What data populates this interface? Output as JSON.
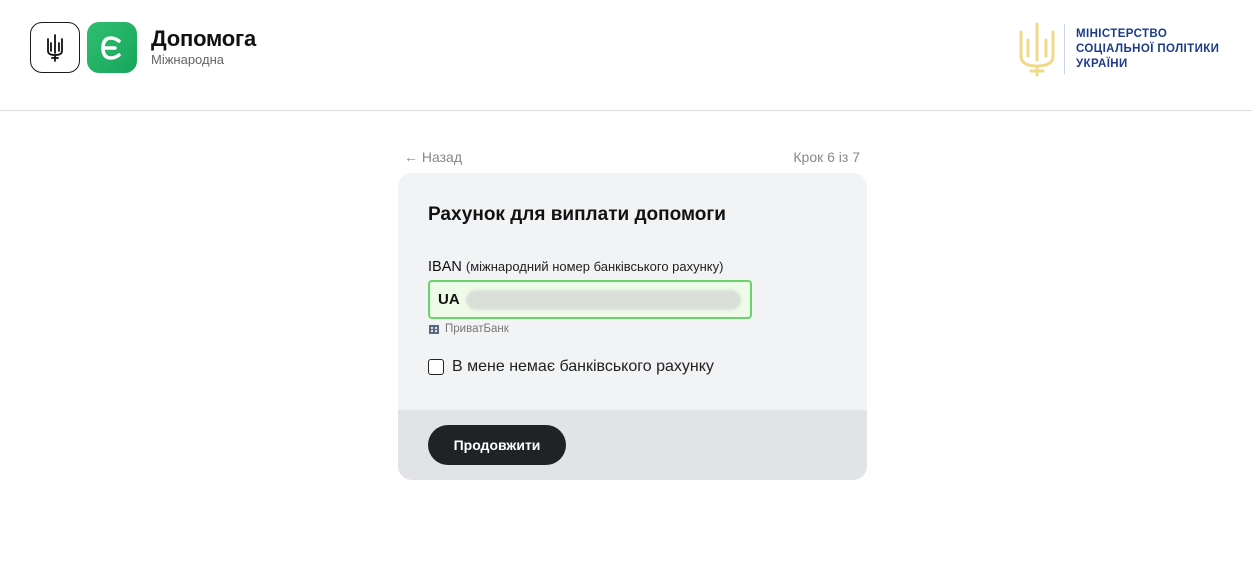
{
  "header": {
    "brand_title": "Допомога",
    "brand_subtitle": "Міжнародна",
    "app_badge_letter": "Є",
    "brand_color": "#1fae63",
    "ministry_lines": [
      "МІНІСТЕРСТВО",
      "СОЦІАЛЬНОЇ ПОЛІТИКИ",
      "УКРАЇНИ"
    ],
    "ministry_color": "#1d3b8a"
  },
  "nav": {
    "back_label": "← Назад",
    "step_label": "Крок 6 із 7"
  },
  "form": {
    "title": "Рахунок для виплати допомоги",
    "iban_label": "IBAN",
    "iban_hint": "(міжнародний номер банківського рахунку)",
    "iban_value_prefix": "UA",
    "bank_name": "ПриватБанк",
    "no_account_label": "В мене немає банківського рахунку",
    "continue_label": "Продовжити"
  },
  "icons": {
    "trident": "trident-icon",
    "ministry_emblem": "ministry-emblem-icon",
    "bank": "bank-icon"
  }
}
